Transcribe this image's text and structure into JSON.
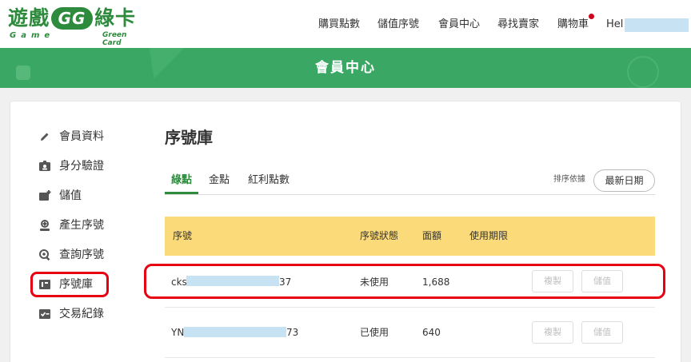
{
  "brand": {
    "logo_main_left": "遊戲",
    "logo_gg": "GG",
    "logo_main_right": "綠卡",
    "logo_sub_left": "Game",
    "logo_sub_right": "Green Card",
    "color": "#2e8b3d"
  },
  "nav": {
    "buy_points": "購買點數",
    "redeem_code": "儲值序號",
    "member_center": "會員中心",
    "find_seller": "尋找賣家",
    "cart": "購物車",
    "user_greeting": "Hel"
  },
  "banner": {
    "title": "會員中心",
    "color": "#3aa864"
  },
  "sidebar": {
    "items": [
      {
        "label": "會員資料",
        "icon": "pencil-icon"
      },
      {
        "label": "身分驗證",
        "icon": "id-card-icon"
      },
      {
        "label": "儲值",
        "icon": "wallet-icon"
      },
      {
        "label": "產生序號",
        "icon": "user-plus-icon"
      },
      {
        "label": "查詢序號",
        "icon": "search-icon"
      },
      {
        "label": "序號庫",
        "icon": "box-icon"
      },
      {
        "label": "交易紀錄",
        "icon": "checklist-icon"
      }
    ],
    "highlight_color": "#e60012"
  },
  "main": {
    "title": "序號庫",
    "tabs": [
      "綠點",
      "金點",
      "紅利點數"
    ],
    "sort_label": "排序依據",
    "sort_value": "最新日期",
    "table": {
      "headers": [
        "序號",
        "序號狀態",
        "面額",
        "使用期限"
      ],
      "rows": [
        {
          "code_prefix": "cks",
          "code_suffix": "37",
          "status": "未使用",
          "amount": "1,688",
          "expiry": "",
          "copy": "複製",
          "redeem": "儲值"
        },
        {
          "code_prefix": "YN",
          "code_suffix": "73",
          "status": "已使用",
          "amount": "640",
          "expiry": "",
          "copy": "複製",
          "redeem": "儲值"
        }
      ]
    },
    "header_color": "#fbda7a"
  }
}
